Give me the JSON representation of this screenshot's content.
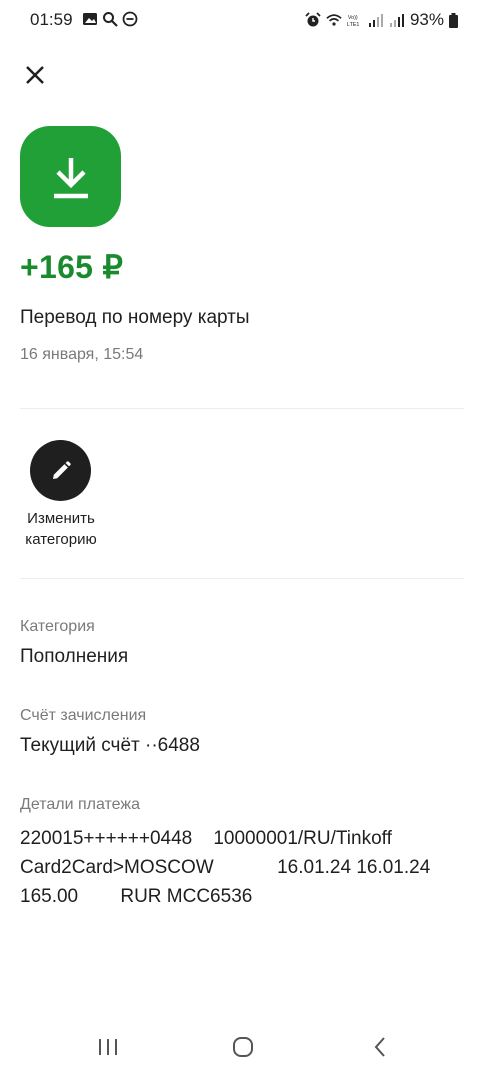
{
  "status_bar": {
    "time": "01:59",
    "battery": "93%",
    "icons": [
      "gallery-icon",
      "search-icon",
      "dnd-icon",
      "alarm-icon",
      "wifi-icon",
      "volte-icon",
      "signal-icon",
      "signal-icon",
      "battery-icon"
    ]
  },
  "operation": {
    "amount": "+165 ₽",
    "title": "Перевод по номеру карты",
    "date": "16 января, 15:54",
    "accent_color": "#21a038",
    "amount_color": "#1a8a2e"
  },
  "actions": {
    "edit_category_label_line1": "Изменить",
    "edit_category_label_line2": "категорию"
  },
  "fields": {
    "category_label": "Категория",
    "category_value": "Пополнения",
    "account_label": "Счёт зачисления",
    "account_value": "Текущий счёт ··6488",
    "details_label": "Детали платежа",
    "details_line1": "220015++++++0448    10000001/RU/Tinkoff",
    "details_line2": "Card2Card>MOSCOW            16.01.24 16.01.24",
    "details_line3": "165.00        RUR MCC6536"
  }
}
